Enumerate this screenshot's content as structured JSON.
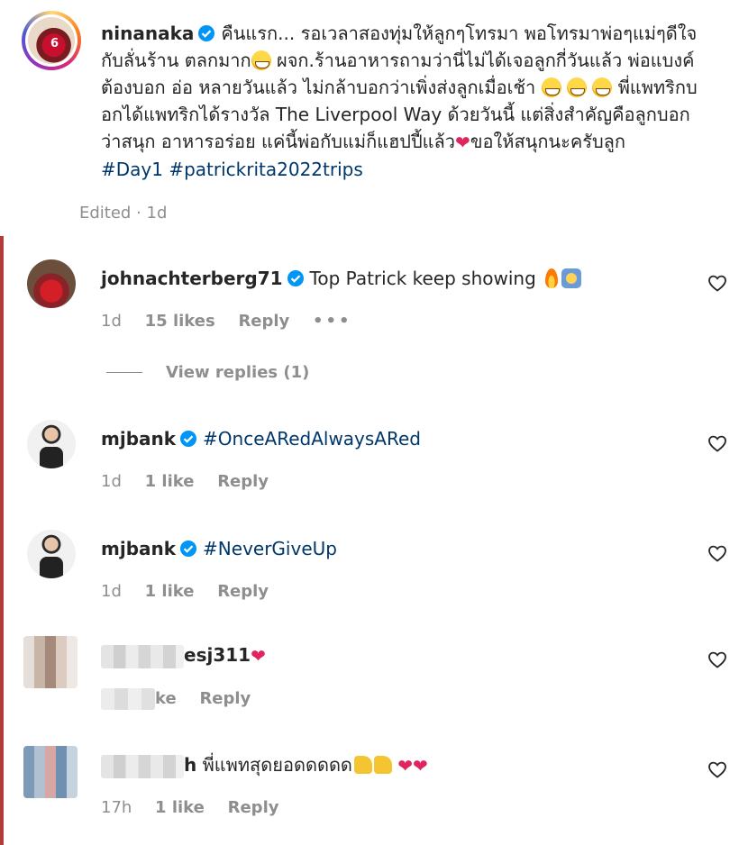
{
  "post": {
    "username": "ninanaka",
    "caption_part1": "คืนแรก... รอเวลาสองทุ่มให้ลูกๆโทรมา พอโทรมาพ่อๆแม่ๆดีใจกับลั่นร้าน ตลกมาก",
    "caption_part2": " ผจก.ร้านอาหารถามว่านี่ไม่ได้เจอลูกกี่วันแล้ว พ่อแบงค์ต้องบอก อ่อ หลายวันแล้ว ไม่กล้าบอกว่าเพิ่งส่งลูกเมื่อเช้า ",
    "caption_part3": " พี่แพทริกบอกได้แพทริกได้รางวัล The Liverpool Way ด้วยวันนี้ แต่สิ่งสำคัญคือลูกบอกว่าสนุก อาหารอร่อย แค่นี้พ่อกับแม่ก็แฮปปี้แล้ว",
    "caption_part4": "ขอให้สนุกนะครับลูก",
    "hashtags": "#Day1 #patrickrita2022trips",
    "edited": "Edited · 1d"
  },
  "comments": [
    {
      "username": "johnachterberg71",
      "text": "Top Patrick keep showing",
      "time": "1d",
      "likes": "15 likes",
      "reply": "Reply",
      "more": "•••",
      "view_replies": "View replies (1)"
    },
    {
      "username": "mjbank",
      "text": "#OnceARedAlwaysARed",
      "time": "1d",
      "likes": "1 like",
      "reply": "Reply"
    },
    {
      "username": "mjbank",
      "text": "#NeverGiveUp",
      "time": "1d",
      "likes": "1 like",
      "reply": "Reply"
    },
    {
      "username_visible": "esj311",
      "likes_visible": "ke",
      "reply": "Reply"
    },
    {
      "username_visible": "h",
      "text": "พี่แพทสุดยอดดดดด",
      "time": "17h",
      "likes": "1 like",
      "reply": "Reply"
    }
  ],
  "icons": {
    "verified": "verified-badge-icon",
    "like": "heart-outline-icon"
  },
  "colors": {
    "hashtag": "#00376b",
    "verified": "#0095f6",
    "secondary_text": "#8e8e8e"
  }
}
